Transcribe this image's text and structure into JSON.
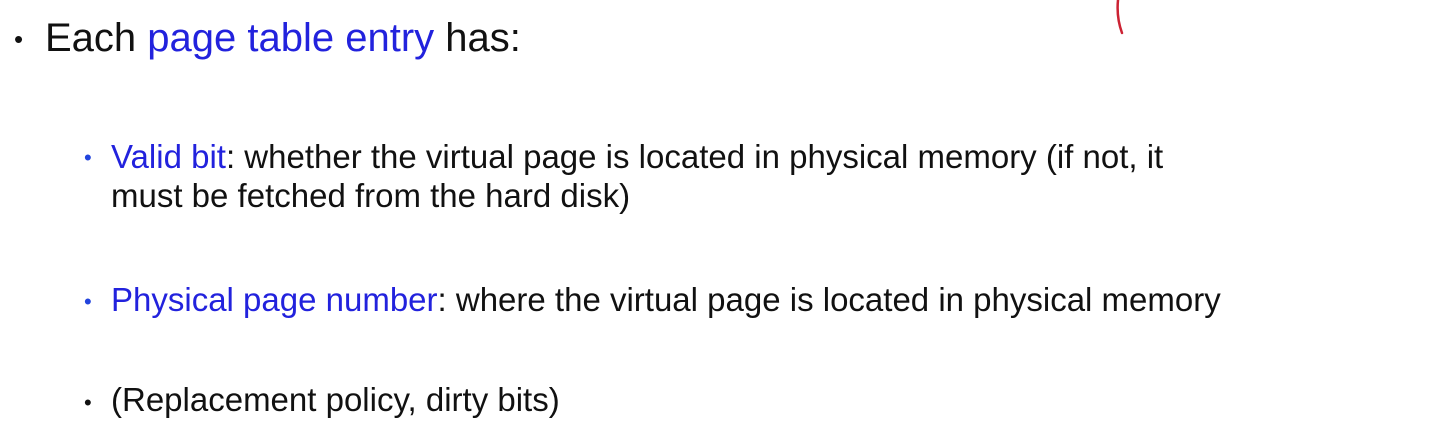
{
  "main_bullet": {
    "prefix": "Each ",
    "highlight": "page table entry",
    "suffix": " has:"
  },
  "sub_bullets": [
    {
      "term": "Valid bit",
      "line1": ": whether the virtual page is located in physical memory (if not, it",
      "line2": "must be fetched from the hard disk)"
    },
    {
      "term": "Physical page number",
      "line1": ": where the virtual page is located in physical memory"
    },
    {
      "text": "(Replacement policy, dirty bits)"
    }
  ],
  "colors": {
    "highlight": "#2222dd",
    "text": "#111111",
    "annotation": "#cc2233"
  }
}
